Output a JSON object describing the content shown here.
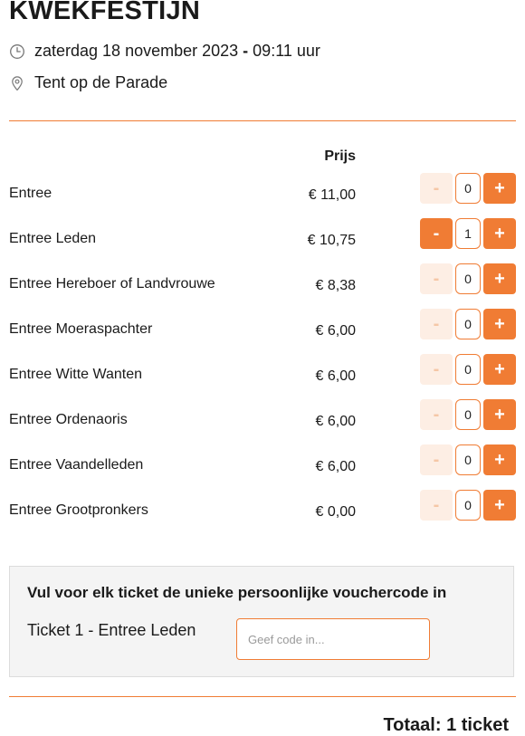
{
  "event": {
    "title": "KWÈKFESTIJN",
    "date": "zaterdag 18 november 2023",
    "date_separator": "-",
    "time": "09:11 uur",
    "location": "Tent op de Parade"
  },
  "table": {
    "price_header": "Prijs",
    "rows": [
      {
        "name": "Entree",
        "price": "€ 11,00",
        "quantity": "0",
        "minus": "-",
        "plus": "+"
      },
      {
        "name": "Entree Leden",
        "price": "€ 10,75",
        "quantity": "1",
        "minus": "-",
        "plus": "+"
      },
      {
        "name": "Entree Hereboer of Landvrouwe",
        "price": "€ 8,38",
        "quantity": "0",
        "minus": "-",
        "plus": "+"
      },
      {
        "name": "Entree Moeraspachter",
        "price": "€ 6,00",
        "quantity": "0",
        "minus": "-",
        "plus": "+"
      },
      {
        "name": "Entree Witte Wanten",
        "price": "€ 6,00",
        "quantity": "0",
        "minus": "-",
        "plus": "+"
      },
      {
        "name": "Entree Ordenaoris",
        "price": "€ 6,00",
        "quantity": "0",
        "minus": "-",
        "plus": "+"
      },
      {
        "name": "Entree Vaandelleden",
        "price": "€ 6,00",
        "quantity": "0",
        "minus": "-",
        "plus": "+"
      },
      {
        "name": "Entree Grootpronkers",
        "price": "€ 0,00",
        "quantity": "0",
        "minus": "-",
        "plus": "+"
      }
    ]
  },
  "voucher": {
    "title": "Vul voor elk ticket de unieke persoonlijke vouchercode in",
    "ticket_label": "Ticket 1 - Entree Leden",
    "placeholder": "Geef code in...",
    "value": ""
  },
  "total": "Totaal: 1 ticket",
  "colors": {
    "accent": "#f07c34",
    "accent_light": "#fdeee4",
    "panel_bg": "#f4f4f4"
  },
  "icons": {
    "date": "clock-icon",
    "location": "map-pin-icon"
  }
}
